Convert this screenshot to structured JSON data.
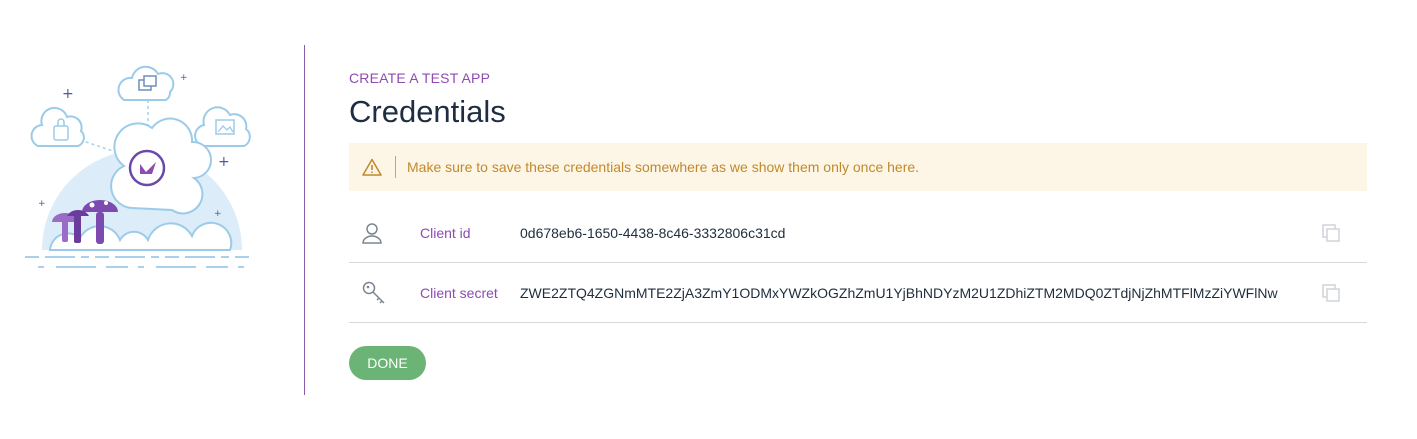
{
  "header": {
    "eyebrow": "CREATE A TEST APP",
    "title": "Credentials"
  },
  "alert": {
    "message": "Make sure to save these credentials somewhere as we show them only once here.",
    "icon": "warning-icon"
  },
  "credentials": [
    {
      "label": "Client id",
      "value": "0d678eb6-1650-4438-8c46-3332806c31cd",
      "icon": "user-icon"
    },
    {
      "label": "Client secret",
      "value": "ZWE2ZTQ4ZGNmMTE2ZjA3ZmY1ODMxYWZkOGZhZmU1YjBhNDYzM2U1ZDhiZTM2MDQ0ZTdjNjZhMTFlMzZiYWFlNw",
      "icon": "key-icon"
    }
  ],
  "actions": {
    "done_label": "DONE"
  },
  "colors": {
    "accent": "#8e4bb0",
    "title": "#1e2d42",
    "alert_bg": "#fdf5e6",
    "alert_text": "#c08a2c",
    "done_button": "#6bb476"
  }
}
